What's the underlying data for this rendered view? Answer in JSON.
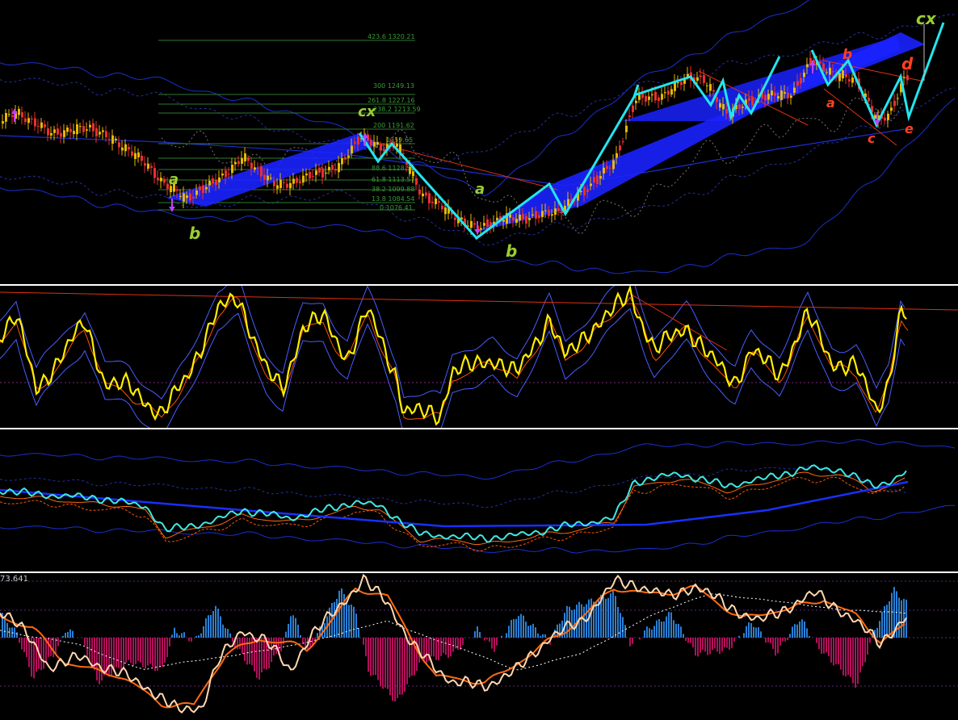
{
  "colors": {
    "background": "#000000",
    "separator": "#ffffff",
    "bull_candle": "#e6b800",
    "bear_candle": "#e83030",
    "band": "#1a2fd0",
    "band_dashed": "#2430a0",
    "channel_fill": "#1a22ff",
    "wave_line": "#22e6f0",
    "fib_line": "#2f7a2f",
    "fib_text": "#3a9a3a",
    "wave_label_green": "#9acd32",
    "wave_label_red": "#ff4020",
    "arrow": "#c040ff",
    "oscillator": "#ffee00",
    "oscillator_signal": "#ff5500",
    "oscillator_band": "#4a5cff",
    "trend_line": "#e03010",
    "price_line": "#40e8e0",
    "ma_thick": "#1830ff",
    "hist_pos": "#2a7fd4",
    "hist_neg": "#b0105a",
    "fast_line": "#ffd8b0",
    "slow_line": "#ff6a10",
    "dotted_line": "#ffffff"
  },
  "price_pane": {
    "fib_levels": [
      {
        "label": "423.6 1320.21"
      },
      {
        "label": "300 1249.13"
      },
      {
        "label": "261.8 1227.16"
      },
      {
        "label": "238.2 1213.59"
      },
      {
        "label": "200 1191.62"
      },
      {
        "label": "1159.65"
      },
      {
        "label": "88.6 1128.58"
      },
      {
        "label": "61.8 1113.57"
      },
      {
        "label": "38.2 1099.88"
      },
      {
        "label": "13.8 1084.54"
      },
      {
        "label": "0 1076.41"
      }
    ],
    "wave_labels": [
      {
        "text": "a",
        "color": "green"
      },
      {
        "text": "b",
        "color": "green"
      },
      {
        "text": "cx",
        "color": "green"
      },
      {
        "text": "a",
        "color": "green"
      },
      {
        "text": "b",
        "color": "green"
      },
      {
        "text": "a",
        "color": "red"
      },
      {
        "text": "b",
        "color": "red"
      },
      {
        "text": "c",
        "color": "red"
      },
      {
        "text": "d",
        "color": "red"
      },
      {
        "text": "e",
        "color": "red"
      },
      {
        "text": "cx",
        "color": "green"
      }
    ]
  },
  "oscillator_pane": {},
  "price_line_pane": {},
  "histogram_pane": {
    "readout": "73.641"
  }
}
